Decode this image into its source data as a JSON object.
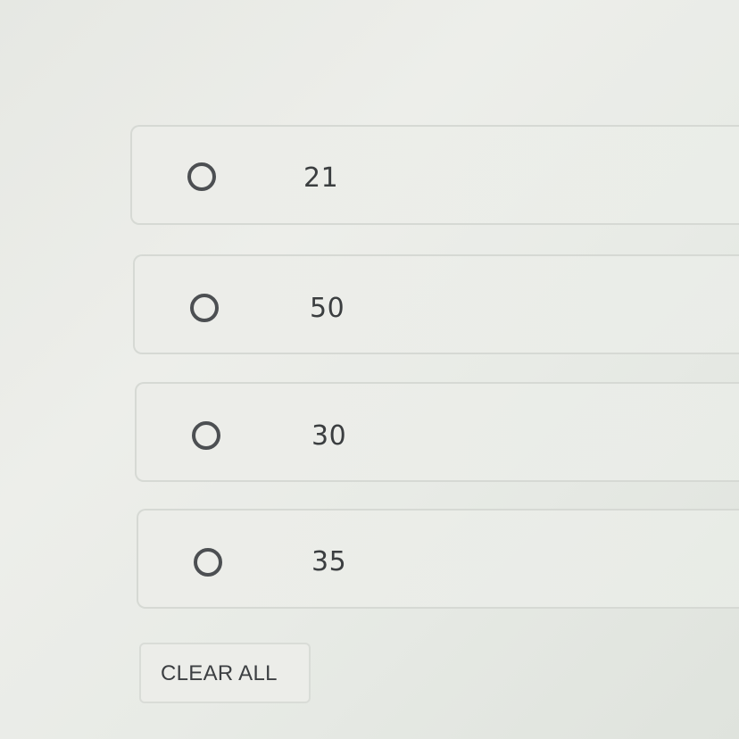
{
  "options": [
    {
      "label": "21"
    },
    {
      "label": "50"
    },
    {
      "label": "30"
    },
    {
      "label": "35"
    }
  ],
  "clear_button": {
    "label": "CLEAR ALL"
  },
  "colors": {
    "radio_border": "#4c4f52",
    "text": "#3b3e40",
    "card_border": "#d6d9d4"
  }
}
